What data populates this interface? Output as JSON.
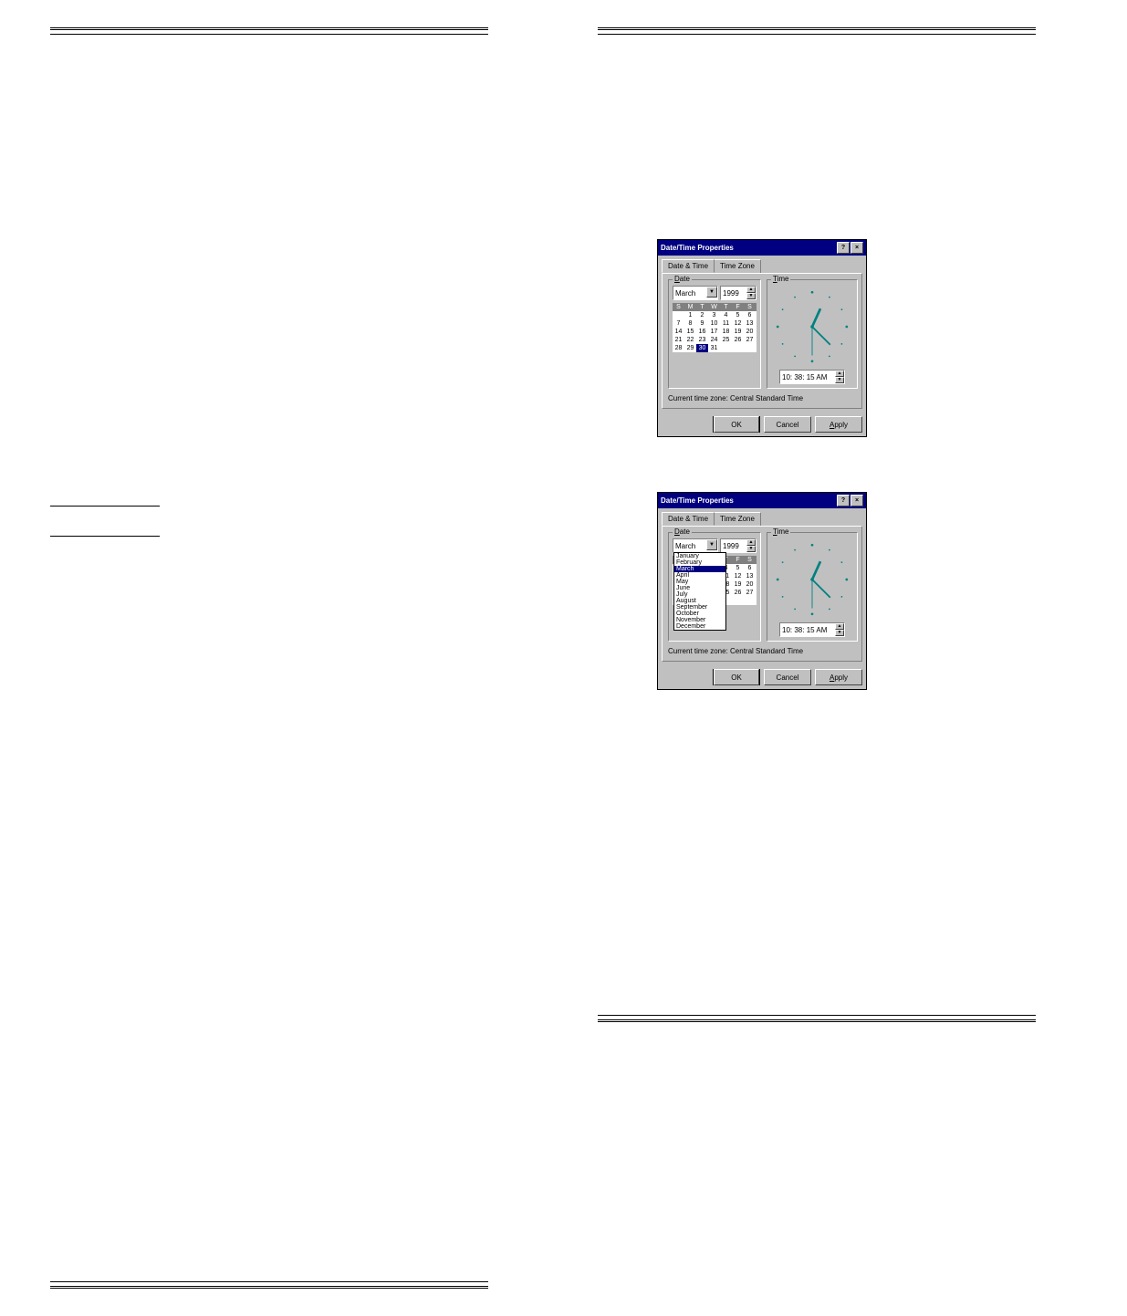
{
  "dialog": {
    "title": "Date/Time Properties",
    "tab1": "Date & Time",
    "tab2": "Time Zone",
    "date_label": "Date",
    "time_label": "Time",
    "month": "March",
    "year": "1999",
    "days": [
      "S",
      "M",
      "T",
      "W",
      "T",
      "F",
      "S"
    ],
    "cal": [
      [
        "",
        "1",
        "2",
        "3",
        "4",
        "5",
        "6"
      ],
      [
        "7",
        "8",
        "9",
        "10",
        "11",
        "12",
        "13"
      ],
      [
        "14",
        "15",
        "16",
        "17",
        "18",
        "19",
        "20"
      ],
      [
        "21",
        "22",
        "23",
        "24",
        "25",
        "26",
        "27"
      ],
      [
        "28",
        "29",
        "30",
        "31",
        "",
        "",
        ""
      ]
    ],
    "selected_day": "30",
    "time_value": "10: 38: 15 AM",
    "tz_line": "Current time zone:  Central Standard Time",
    "btn_ok": "OK",
    "btn_cancel": "Cancel",
    "btn_apply": "Apply",
    "months_list": [
      "January",
      "February",
      "March",
      "April",
      "May",
      "June",
      "July",
      "August",
      "October",
      "September",
      "November",
      "December"
    ]
  }
}
